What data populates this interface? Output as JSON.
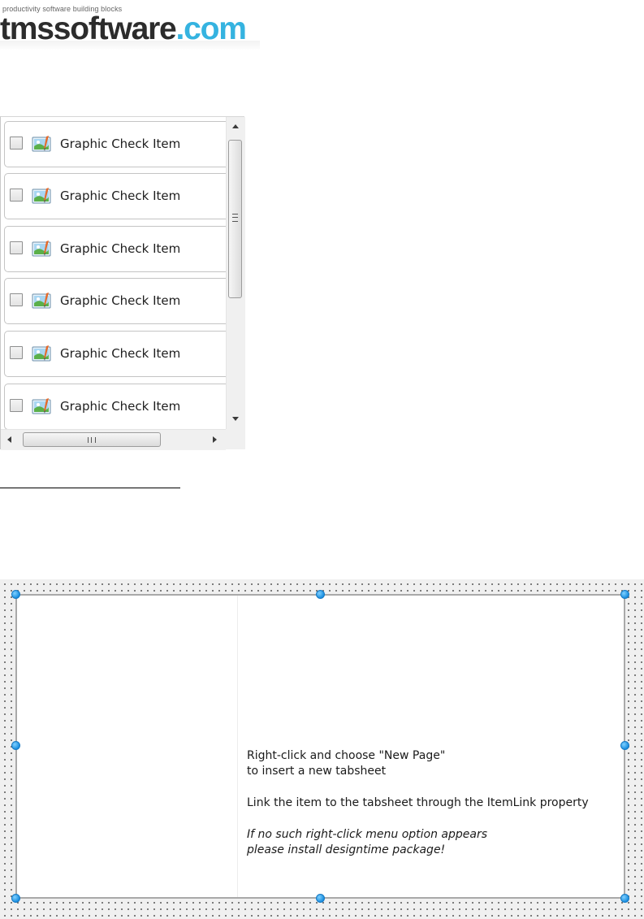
{
  "logo": {
    "tagline": "productivity software building blocks",
    "main": "tmssoftware",
    "tld": ".com",
    "colors": {
      "main": "#2c2c2c",
      "tld": "#35b3e0"
    }
  },
  "checklist": {
    "items": [
      {
        "label": "Graphic Check Item",
        "checked": false,
        "icon": "picture-icon"
      },
      {
        "label": "Graphic Check Item",
        "checked": false,
        "icon": "picture-icon"
      },
      {
        "label": "Graphic Check Item",
        "checked": false,
        "icon": "picture-icon"
      },
      {
        "label": "Graphic Check Item",
        "checked": false,
        "icon": "picture-icon"
      },
      {
        "label": "Graphic Check Item",
        "checked": false,
        "icon": "picture-icon"
      },
      {
        "label": "Graphic Check Item",
        "checked": false,
        "icon": "picture-icon"
      }
    ],
    "hscroll_grip": "III"
  },
  "designer": {
    "line1": "Right-click and choose \"New Page\"",
    "line2": "to insert a new tabsheet",
    "line3": "Link the item to the tabsheet through the ItemLink property",
    "line4": "If no such right-click menu option appears",
    "line5": "please install designtime package!",
    "handle_color": "#1b8fe0"
  }
}
